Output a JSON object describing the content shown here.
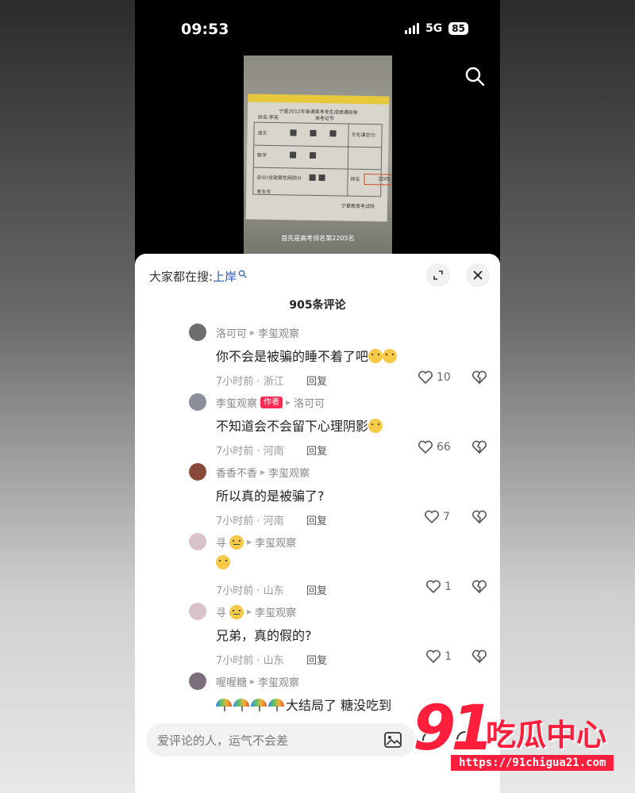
{
  "status": {
    "time": "09:53",
    "network": "5G",
    "battery": "85"
  },
  "video": {
    "doc_title": "宁夏2012年普通高考考生成绩通知单",
    "labels": [
      "姓名:李宪",
      "准考证号",
      "语文",
      "文化课总分:",
      "数学",
      "总分(含政策性照顾分",
      "排名",
      "考生号",
      "宁夏教育考试院"
    ],
    "rank_value": "2205",
    "caption": "首先是高考排名第2205名"
  },
  "sheet": {
    "search_prefix": "大家都在搜:",
    "search_keyword": "上岸",
    "comment_count": "905条评论"
  },
  "comments": [
    {
      "user": "洛可可",
      "to": "李玺观察",
      "text": "你不会是被骗的睡不着了吧",
      "emoji_after": "grin-sweat x2",
      "time_loc": "7小时前 · 浙江",
      "reply": "回复",
      "likes": "10",
      "author": false,
      "avatar_color": "#6d6d6d"
    },
    {
      "user": "李玺观察",
      "badge": "作者",
      "to": "洛可可",
      "text": "不知道会不会留下心理阴影",
      "emoji_after": "laugh-tear",
      "time_loc": "7小时前 · 河南",
      "reply": "回复",
      "likes": "66",
      "author": true,
      "avatar_color": "#8a8f99"
    },
    {
      "user": "香香不香",
      "to": "李玺观察",
      "text": "所以真的是被骗了?",
      "time_loc": "7小时前 · 河南",
      "reply": "回复",
      "likes": "7",
      "author": false,
      "avatar_color": "#8a4a3a"
    },
    {
      "user": "寻",
      "to": "李玺观察",
      "text": "",
      "emoji_only": "flushed",
      "time_loc": "7小时前 · 山东",
      "reply": "回复",
      "likes": "1",
      "author": false,
      "avatar_color": "#d9c3c8"
    },
    {
      "user": "寻",
      "to": "李玺观察",
      "text": "兄弟，真的假的?",
      "time_loc": "7小时前 · 山东",
      "reply": "回复",
      "likes": "1",
      "author": false,
      "avatar_color": "#d9c3c8"
    },
    {
      "user": "喔喔糖",
      "to": "李玺观察",
      "text": "大结局了 糖没吃到",
      "emoji_before": "umbrella x4",
      "author": false,
      "avatar_color": "#7a6f7a"
    }
  ],
  "input": {
    "placeholder": "爱评论的人，运气不会差"
  },
  "watermark": {
    "logo": "91",
    "name": "吃瓜中心",
    "url": "https://91chigua21.com"
  },
  "icons": [
    "search-icon",
    "expand-icon",
    "close-icon",
    "heart-icon",
    "broken-heart-icon",
    "image-icon",
    "at-icon",
    "smile-icon"
  ]
}
